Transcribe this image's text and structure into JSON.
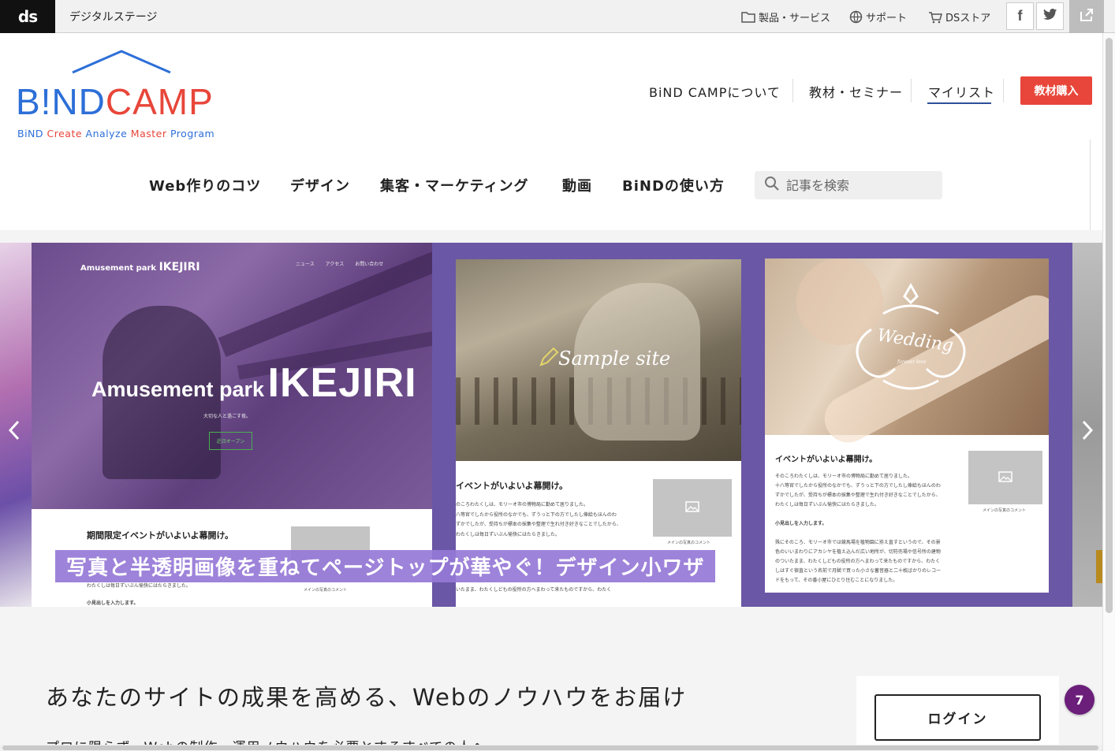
{
  "topbar": {
    "logo": "ds",
    "brand": "デジタルステージ",
    "links": [
      "製品・サービス",
      "サポート",
      "DSストア"
    ],
    "social": [
      "f",
      "twitter"
    ]
  },
  "logo": {
    "word_blue": "B!ND",
    "word_red": "CAMP",
    "tagline": [
      "BiND",
      "Create",
      "Analyze",
      "Master",
      "Program"
    ]
  },
  "nav_primary": {
    "about": "BiND CAMPについて",
    "seminar": "教材・セミナー",
    "mylist": "マイリスト",
    "buy": "教材購入"
  },
  "nav_secondary": [
    "Web作りのコツ",
    "デザイン",
    "集客・マーケティング",
    "動画",
    "BiNDの使い方"
  ],
  "search": {
    "placeholder": "記事を検索"
  },
  "hero": {
    "arrow_prev": "‹",
    "arrow_next": "›",
    "caption": "写真と半透明画像を重ねてページトップが華やぐ！デザイン小ワザ",
    "panel1": {
      "small_pre": "Amusement park",
      "small_name": "IKEJIRI",
      "menu": "ニュース アクセス お問い合わせ",
      "title_small": "Amusement park",
      "title_large": "IKEJIRI",
      "sub": "大切な人と過ごす夜。",
      "button": "近日オープン",
      "heading": "期間限定イベントがいよいよ幕開け。",
      "caption": "メインの写真のコメント",
      "line1": "わたくしは毎日ずいぶん愉快にはたらきました。",
      "line2": "小見出しを入力します。"
    },
    "panel2": {
      "title": "Sample site",
      "heading": "イベントがいよいよ幕開け。",
      "body": [
        "のころわたくしは、モリーオ市の博物局に勤めて居りました。",
        "八等官でしたから役所のなかでも、ずうっと下の方でしたし俸給もほんのわ",
        "ずかでしたが、受持ちが標本の採集や整理で生れ付き好きなことでしたから、",
        "わたくしは毎日ずいぶん愉快にはたらきました。"
      ],
      "caption": "メインの写真のコメント",
      "bottom": "いたまま、わたくしどもの役所の方へまわって来たものですから、わたく"
    },
    "panel3": {
      "title": "Wedding",
      "sub": "forever love",
      "heading": "イベントがいよいよ幕開け。",
      "body": [
        "そのころわたくしは、モリーオ市の博物局に勤めて居りました。",
        "十八等官でしたから役所のなかでも、ずうっと下の方でしたし俸給もほんのわ",
        "ずかでしたが、受持ちが標本の採集や整理で生れ付き好きなことでしたから、",
        "わたくしは毎日ずいぶん愉快にはたらきました。",
        "",
        "小見出しを入力します。",
        "",
        "殊にそのころ、モリーオ市では競馬場を植物園に拵え直すというので、その景",
        "色のいいまわりにアカシヤを植え込んだ広い地所が、切符売場や信号所の建物",
        "のついたまま、わたくしどもの役所の方へまわって来たものですから、わたく",
        "しはすぐ宿直という名前で月賦で買った小さな蓄音器と二十枚ばかりのレコー",
        "ドをもって、その番小屋にひとり住むことになりました。"
      ],
      "caption": "メインの写真のコメント"
    }
  },
  "main": {
    "title": "あなたのサイトの成果を高める、Webのノウハウをお届け",
    "sub": "プロに限らず、Webの制作・運用ノウハウを必要とするすべての人へ"
  },
  "login": {
    "label": "ログイン"
  },
  "badge": {
    "count": "7"
  },
  "colors": {
    "brand_blue": "#2d6fd8",
    "brand_red": "#e8463a",
    "hero_purple": "#6a57a6",
    "caption_purple": "#9678d7",
    "badge": "#6b1f7a"
  }
}
